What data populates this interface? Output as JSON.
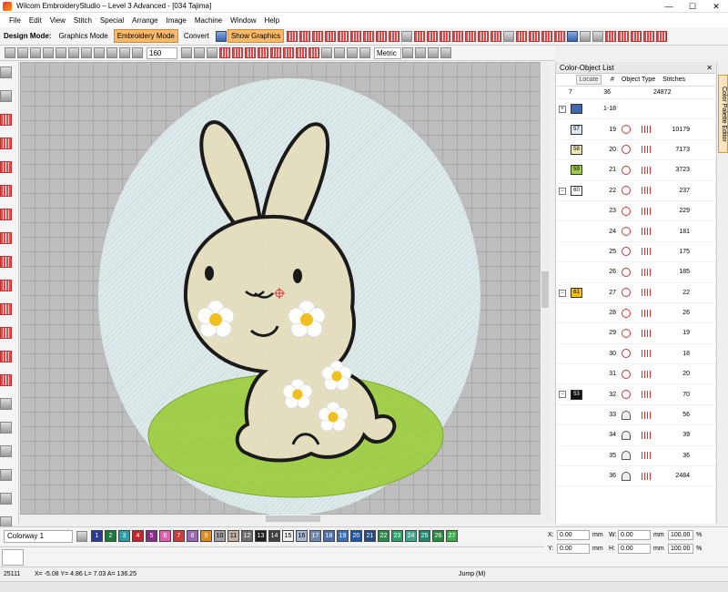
{
  "window": {
    "title": "Wilcom EmbroideryStudio – Level 3 Advanced - [034       Tajima]",
    "min": "—",
    "max": "☐",
    "close": "✕"
  },
  "menu": [
    "File",
    "Edit",
    "View",
    "Stitch",
    "Special",
    "Arrange",
    "Image",
    "Machine",
    "Window",
    "Help"
  ],
  "toolbar1": {
    "design_mode_label": "Design Mode:",
    "graphics_mode": "Graphics Mode",
    "embroidery_mode": "Embroidery Mode",
    "convert": "Convert",
    "show_graphics": "Show Graphics"
  },
  "toolbar2": {
    "zoom": "160",
    "units": "Metric"
  },
  "color_object_list": {
    "title": "Color-Object List",
    "headers": {
      "locate": "Locate",
      "number": "#",
      "object_type": "Object Type",
      "stitches": "Stitches"
    },
    "totals": {
      "colors": "7",
      "objects": "36",
      "stitches": "24872"
    },
    "rows": [
      {
        "expander": "+",
        "swatch_num": "",
        "num": "1-18",
        "count": "",
        "swatch_color": "#4466aa"
      },
      {
        "expander": "",
        "swatch_num": "57",
        "num": "19",
        "count": "10179",
        "swatch_color": "#dde8f0"
      },
      {
        "expander": "",
        "swatch_num": "58",
        "num": "20",
        "count": "7173",
        "swatch_color": "#efe6b8"
      },
      {
        "expander": "",
        "swatch_num": "59",
        "num": "21",
        "count": "3723",
        "swatch_color": "#9ccc4a"
      },
      {
        "expander": "−",
        "swatch_num": "60",
        "num": "22",
        "count": "237",
        "swatch_color": "#ffffff"
      },
      {
        "expander": "",
        "swatch_num": "",
        "num": "23",
        "count": "229",
        "swatch_color": ""
      },
      {
        "expander": "",
        "swatch_num": "",
        "num": "24",
        "count": "181",
        "swatch_color": ""
      },
      {
        "expander": "",
        "swatch_num": "",
        "num": "25",
        "count": "175",
        "swatch_color": ""
      },
      {
        "expander": "",
        "swatch_num": "",
        "num": "26",
        "count": "185",
        "swatch_color": ""
      },
      {
        "expander": "−",
        "swatch_num": "61",
        "num": "27",
        "count": "22",
        "swatch_color": "#f0c020"
      },
      {
        "expander": "",
        "swatch_num": "",
        "num": "28",
        "count": "26",
        "swatch_color": ""
      },
      {
        "expander": "",
        "swatch_num": "",
        "num": "29",
        "count": "19",
        "swatch_color": ""
      },
      {
        "expander": "",
        "swatch_num": "",
        "num": "30",
        "count": "18",
        "swatch_color": ""
      },
      {
        "expander": "",
        "swatch_num": "",
        "num": "31",
        "count": "20",
        "swatch_color": ""
      },
      {
        "expander": "−",
        "swatch_num": "53",
        "num": "32",
        "count": "70",
        "swatch_color": "#111111"
      },
      {
        "expander": "",
        "swatch_num": "",
        "num": "33",
        "count": "56",
        "swatch_color": ""
      },
      {
        "expander": "",
        "swatch_num": "",
        "num": "34",
        "count": "39",
        "swatch_color": ""
      },
      {
        "expander": "",
        "swatch_num": "",
        "num": "35",
        "count": "36",
        "swatch_color": ""
      },
      {
        "expander": "",
        "swatch_num": "",
        "num": "36",
        "count": "2484",
        "swatch_color": ""
      }
    ]
  },
  "side_tab": "Color Palette Editor",
  "colorbar": {
    "colorway": "Colorway 1",
    "chips": [
      {
        "n": "1",
        "c": "#2b3a9a"
      },
      {
        "n": "2",
        "c": "#1e7a3c"
      },
      {
        "n": "3",
        "c": "#2aa0a8"
      },
      {
        "n": "4",
        "c": "#c0282a"
      },
      {
        "n": "5",
        "c": "#8a2a8a"
      },
      {
        "n": "6",
        "c": "#e060b0"
      },
      {
        "n": "7",
        "c": "#d03a3a"
      },
      {
        "n": "8",
        "c": "#9a6ab0"
      },
      {
        "n": "9",
        "c": "#e08a20"
      },
      {
        "n": "10",
        "c": "#a0a0a0"
      },
      {
        "n": "11",
        "c": "#c0b0a0"
      },
      {
        "n": "12",
        "c": "#707070"
      },
      {
        "n": "13",
        "c": "#202020"
      },
      {
        "n": "14",
        "c": "#404040"
      },
      {
        "n": "15",
        "c": "#f0f0f0"
      },
      {
        "n": "16",
        "c": "#a8b8d0"
      },
      {
        "n": "17",
        "c": "#7088b0"
      },
      {
        "n": "18",
        "c": "#5070a8"
      },
      {
        "n": "19",
        "c": "#3a70c0"
      },
      {
        "n": "20",
        "c": "#2058a8"
      },
      {
        "n": "21",
        "c": "#284a88"
      },
      {
        "n": "22",
        "c": "#308a50"
      },
      {
        "n": "23",
        "c": "#28a068"
      },
      {
        "n": "24",
        "c": "#40a890"
      },
      {
        "n": "25",
        "c": "#208a70"
      },
      {
        "n": "26",
        "c": "#2a8a40"
      },
      {
        "n": "27",
        "c": "#38b048"
      }
    ]
  },
  "position": {
    "x_label": "X:",
    "y_label": "Y:",
    "w_label": "W:",
    "h_label": "H:",
    "x": "0.00",
    "y": "0.00",
    "w": "0.00",
    "h": "0.00",
    "unit": "mm",
    "w_pct": "100.00",
    "h_pct": "100.00",
    "pct_unit": "%"
  },
  "status": {
    "stitch": "25111",
    "coords": "X=  -5.08 Y=  4.86 L=  7.03 A= 136.25",
    "mode": "Jump (M)"
  }
}
